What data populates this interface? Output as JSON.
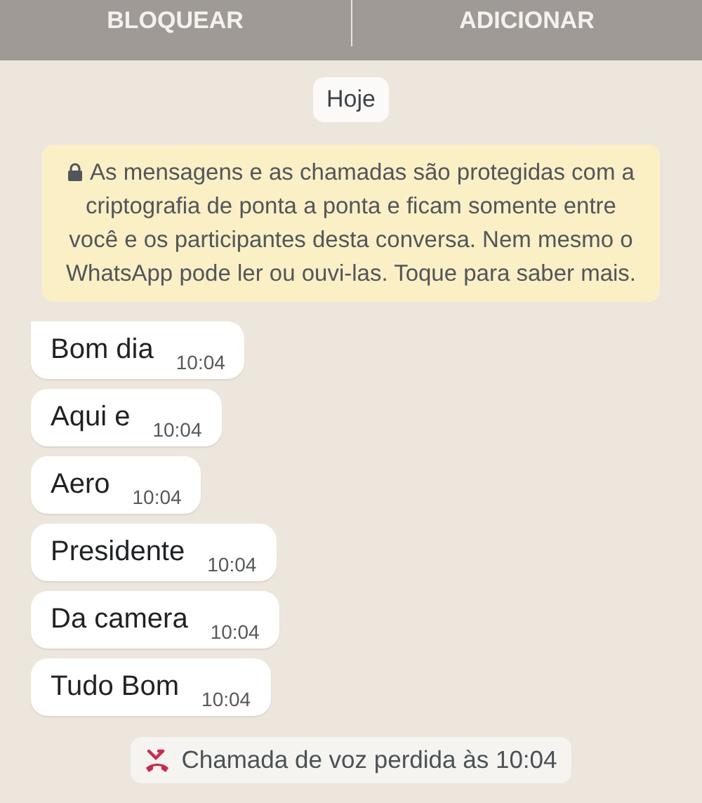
{
  "action_bar": {
    "buttons": [
      "BLOQUEAR",
      "ADICIONAR"
    ]
  },
  "date_pill": "Hoje",
  "encryption_notice": "As mensagens e as chamadas são protegidas com a criptografia de ponta a ponta e ficam somente entre você e os participantes desta conversa. Nem mesmo o WhatsApp pode ler ou ouvi-las. Toque para saber mais.",
  "messages": [
    {
      "text": "Bom dia",
      "time": "10:04",
      "tail": true
    },
    {
      "text": "Aqui e",
      "time": "10:04",
      "tail": false
    },
    {
      "text": "Aero",
      "time": "10:04",
      "tail": false
    },
    {
      "text": "Presidente",
      "time": "10:04",
      "tail": false
    },
    {
      "text": "Da camera",
      "time": "10:04",
      "tail": false
    },
    {
      "text": "Tudo Bom",
      "time": "10:04",
      "tail": false
    }
  ],
  "missed_call": "Chamada de voz perdida às 10:04"
}
